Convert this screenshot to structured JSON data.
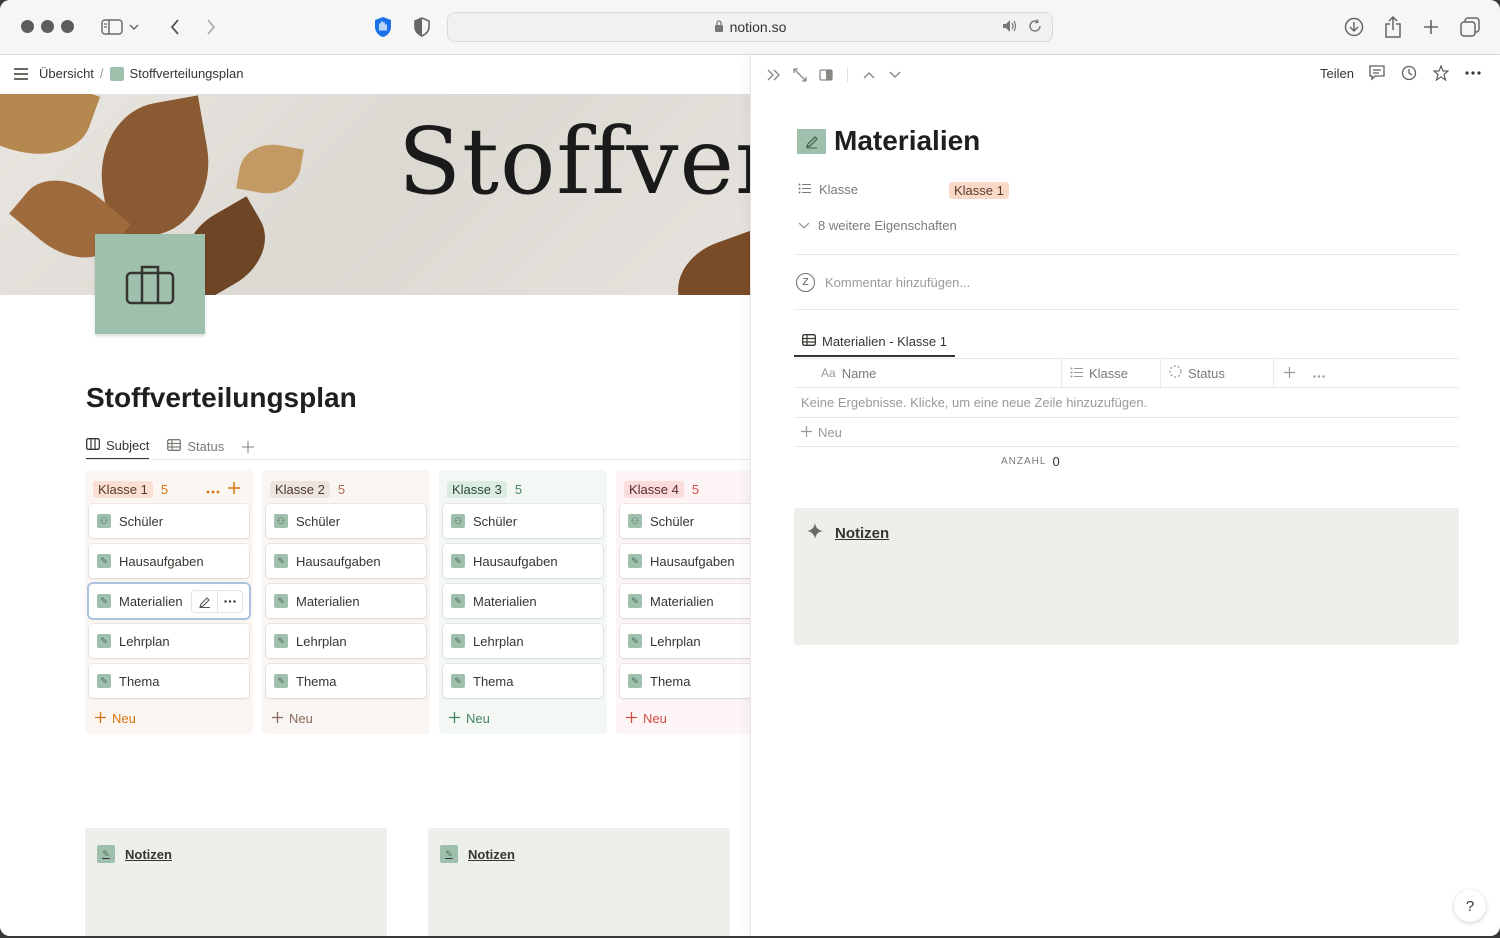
{
  "browser": {
    "url": "notion.so"
  },
  "breadcrumb": {
    "parent": "Übersicht",
    "separator": "/",
    "current": "Stoffverteilungsplan"
  },
  "cover": {
    "title_text": "Stoffver"
  },
  "page": {
    "title": "Stoffverteilungsplan",
    "views": [
      {
        "label": "Subject",
        "icon": "board-icon",
        "active": true
      },
      {
        "label": "Status",
        "icon": "table-icon",
        "active": false
      }
    ]
  },
  "board": {
    "columns": [
      {
        "label": "Klasse 1",
        "count": "5",
        "tag_bg": "#fbdfd2",
        "tag_color": "#5a3a2c",
        "count_color": "#d9730d",
        "col_bg": "#fcf6f3",
        "new_color": "#d9730d",
        "cards": [
          "Schüler",
          "Hausaufgaben",
          "Materialien",
          "Lehrplan",
          "Thema"
        ]
      },
      {
        "label": "Klasse 2",
        "count": "5",
        "tag_bg": "#ede4df",
        "tag_color": "#4a3830",
        "count_color": "#b06a4d",
        "col_bg": "#f9f5f3",
        "new_color": "#8a6a5e",
        "cards": [
          "Schüler",
          "Hausaufgaben",
          "Materialien",
          "Lehrplan",
          "Thema"
        ]
      },
      {
        "label": "Klasse 3",
        "count": "5",
        "tag_bg": "#dcece2",
        "tag_color": "#2c4a36",
        "count_color": "#448361",
        "col_bg": "#f4f8f5",
        "new_color": "#448361",
        "cards": [
          "Schüler",
          "Hausaufgaben",
          "Materialien",
          "Lehrplan",
          "Thema"
        ]
      },
      {
        "label": "Klasse 4",
        "count": "5",
        "tag_bg": "#fbdcdc",
        "tag_color": "#5c2a2a",
        "count_color": "#d44c47",
        "col_bg": "#fdf5f5",
        "new_color": "#d44c47",
        "cards": [
          "Schüler",
          "Hausaufgaben",
          "Materialien",
          "Lehrplan",
          "Thema"
        ]
      }
    ],
    "new_label": "Neu"
  },
  "bottom_notes": [
    "Notizen",
    "Notizen"
  ],
  "peek": {
    "share_label": "Teilen",
    "title": "Materialien",
    "property": {
      "name": "Klasse",
      "value": "Klasse 1"
    },
    "more_properties": "8 weitere Eigenschaften",
    "comment_placeholder": "Kommentar hinzufügen...",
    "avatar_letter": "Z",
    "db_view_label": "Materialien - Klasse 1",
    "columns": [
      {
        "label": "Name",
        "icon": "Aa"
      },
      {
        "label": "Klasse",
        "icon": "list-icon"
      },
      {
        "label": "Status",
        "icon": "status-icon"
      }
    ],
    "empty_text": "Keine Ergebnisse. Klicke, um eine neue Zeile hinzuzufügen.",
    "new_row": "Neu",
    "calc_label": "ANZAHL",
    "calc_value": "0",
    "notes_label": "Notizen"
  },
  "help": "?"
}
